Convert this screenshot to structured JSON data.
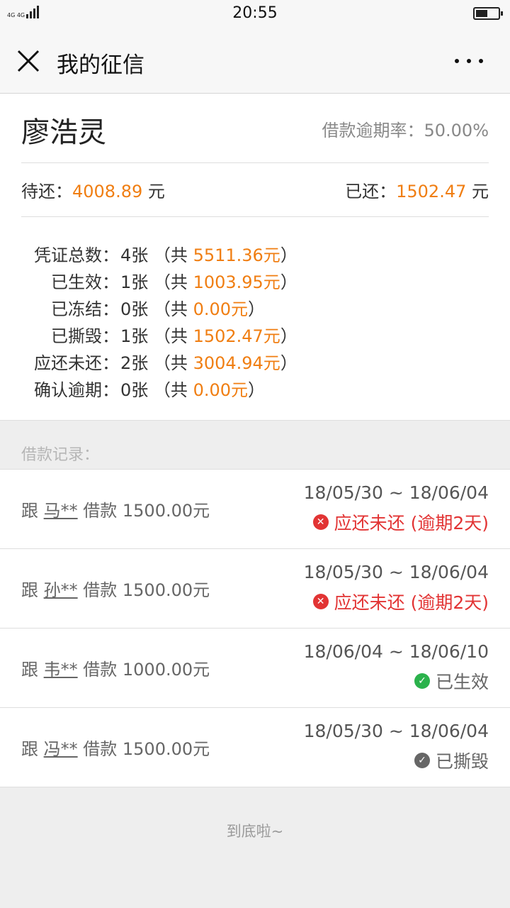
{
  "statusbar": {
    "network": "4G 4G",
    "time": "20:55"
  },
  "navbar": {
    "title": "我的征信",
    "close_icon": "close-icon",
    "more_icon": "more-dots-icon"
  },
  "profile": {
    "name": "廖浩灵",
    "rate_label": "借款逾期率：",
    "rate_value": "50.00%"
  },
  "money": {
    "pending_label": "待还：",
    "pending_value": "4008.89",
    "pending_unit": " 元",
    "paid_label": "已还：",
    "paid_value": "1502.47",
    "paid_unit": " 元"
  },
  "stats": [
    {
      "label": "凭证总数：",
      "count": "4张",
      "open": "（共 ",
      "amount": "5511.36元",
      "close": "）"
    },
    {
      "label": "已生效：",
      "count": "1张",
      "open": "（共 ",
      "amount": "1003.95元",
      "close": "）"
    },
    {
      "label": "已冻结：",
      "count": "0张",
      "open": "（共 ",
      "amount": "0.00元",
      "close": "）"
    },
    {
      "label": "已撕毁：",
      "count": "1张",
      "open": "（共 ",
      "amount": "1502.47元",
      "close": "）"
    },
    {
      "label": "应还未还：",
      "count": "2张",
      "open": "（共 ",
      "amount": "3004.94元",
      "close": "）"
    },
    {
      "label": "确认逾期：",
      "count": "0张",
      "open": "（共 ",
      "amount": "0.00元",
      "close": "）"
    }
  ],
  "records_label": "借款记录：",
  "loans": [
    {
      "prefix": "跟 ",
      "who": "马**",
      "suffix": " 借款 1500.00元",
      "dates": "18/05/30 ~ 18/06/04",
      "status": "应还未还 (逾期2天)",
      "status_type": "overdue",
      "icon": "error-circle-icon"
    },
    {
      "prefix": "跟 ",
      "who": "孙**",
      "suffix": " 借款 1500.00元",
      "dates": "18/05/30 ~ 18/06/04",
      "status": "应还未还 (逾期2天)",
      "status_type": "overdue",
      "icon": "error-circle-icon"
    },
    {
      "prefix": "跟 ",
      "who": "韦**",
      "suffix": " 借款 1000.00元",
      "dates": "18/06/04 ~ 18/06/10",
      "status": "已生效",
      "status_type": "active",
      "icon": "check-circle-icon"
    },
    {
      "prefix": "跟 ",
      "who": "冯**",
      "suffix": " 借款 1500.00元",
      "dates": "18/05/30 ~ 18/06/04",
      "status": "已撕毁",
      "status_type": "torn",
      "icon": "check-circle-icon"
    }
  ],
  "footer": "到底啦~",
  "colors": {
    "orange": "#f07e12",
    "red": "#e23434",
    "green": "#2bb24c",
    "gray_icon": "#666666"
  }
}
